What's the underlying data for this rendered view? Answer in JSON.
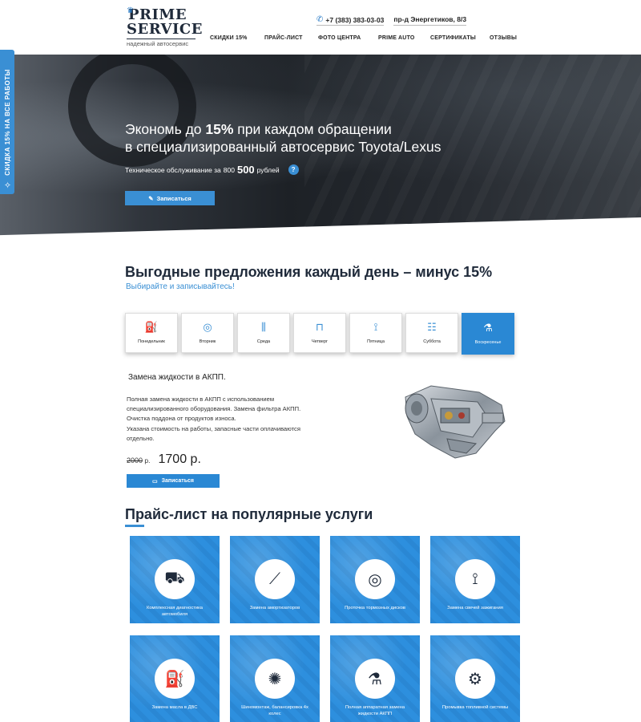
{
  "side_tab": {
    "label": "СКИДКА 15% НА ВСЕ РАБОТЫ"
  },
  "header": {
    "logo": {
      "line1": "PRIME",
      "line2": "SERVICE",
      "tagline": "надежный автосервис"
    },
    "phone": "+7 (383) 383-03-03",
    "address": "пр-д Энергетиков, 8/3",
    "nav": [
      "СКИДКИ 15%",
      "ПРАЙС-ЛИСТ",
      "ФОТО ЦЕНТРА",
      "PRIME AUTO",
      "СЕРТИФИКАТЫ",
      "ОТЗЫВЫ"
    ]
  },
  "hero": {
    "title_pre": "Экономь до ",
    "title_bold": "15%",
    "title_mid": " при каждом обращении",
    "title_line2": "в специализированный автосервис Toyota/Lexus",
    "sub_pre": "Техническое обслуживание за",
    "sub_small": "800",
    "sub_big": "500",
    "sub_post": "рублей",
    "help": "?",
    "button": "Записаться"
  },
  "offers": {
    "title": "Выгодные предложения каждый день – минус 15%",
    "subtitle": "Выбирайте и записывайтесь!",
    "days": [
      {
        "label": "Понедельник",
        "icon": "oil-bottle-icon",
        "glyph": "⛽"
      },
      {
        "label": "Вторник",
        "icon": "brake-disc-icon",
        "glyph": "◎"
      },
      {
        "label": "Среда",
        "icon": "shock-absorber-icon",
        "glyph": "⫼"
      },
      {
        "label": "Четверг",
        "icon": "car-lift-icon",
        "glyph": "⊓"
      },
      {
        "label": "Пятница",
        "icon": "spark-plug-icon",
        "glyph": "⟟"
      },
      {
        "label": "Суббота",
        "icon": "checklist-icon",
        "glyph": "☷"
      },
      {
        "label": "Воскресенье",
        "icon": "transmission-fluid-icon",
        "glyph": "⚗"
      }
    ],
    "active_day": "Воскресенье",
    "item": {
      "name": "Замена жидкости в АКПП.",
      "description": [
        "Полная замена жидкости в АКПП с использованием",
        "специализированного оборудования. Замена фильтра АКПП.",
        "Очистка поддона от продуктов износа.",
        "Указана стоимость на работы, запасные части оплачиваются",
        "отдельно."
      ],
      "old_price": "2000",
      "old_currency": "р.",
      "new_price": "1700 р.",
      "button": "Записаться"
    }
  },
  "price_list": {
    "title": "Прайс-лист на популярные услуги",
    "tiles": [
      {
        "caption": "Комплексная диагностика автомобиля",
        "icon": "car-diagnostics-icon",
        "glyph": "⛟"
      },
      {
        "caption": "Замена амортизаторов",
        "icon": "shock-absorber-icon",
        "glyph": "⟋"
      },
      {
        "caption": "Проточка тормозных дисков",
        "icon": "brake-disc-icon",
        "glyph": "◎"
      },
      {
        "caption": "Замена свечей зажигания",
        "icon": "spark-plug-icon",
        "glyph": "⟟"
      },
      {
        "caption": "Замена масла в ДВС",
        "icon": "oil-can-icon",
        "glyph": "⛽"
      },
      {
        "caption": "Шиномонтаж, балансировка 4х колес",
        "icon": "wheel-icon",
        "glyph": "✺"
      },
      {
        "caption": "Полная аппаратная замена жидкости АКПП",
        "icon": "transmission-fluid-icon",
        "glyph": "⚗"
      },
      {
        "caption": "Промывка топливной системы",
        "icon": "engine-icon",
        "glyph": "⚙"
      }
    ]
  },
  "colors": {
    "accent": "#2a88d4",
    "dark": "#1f2a3a"
  }
}
